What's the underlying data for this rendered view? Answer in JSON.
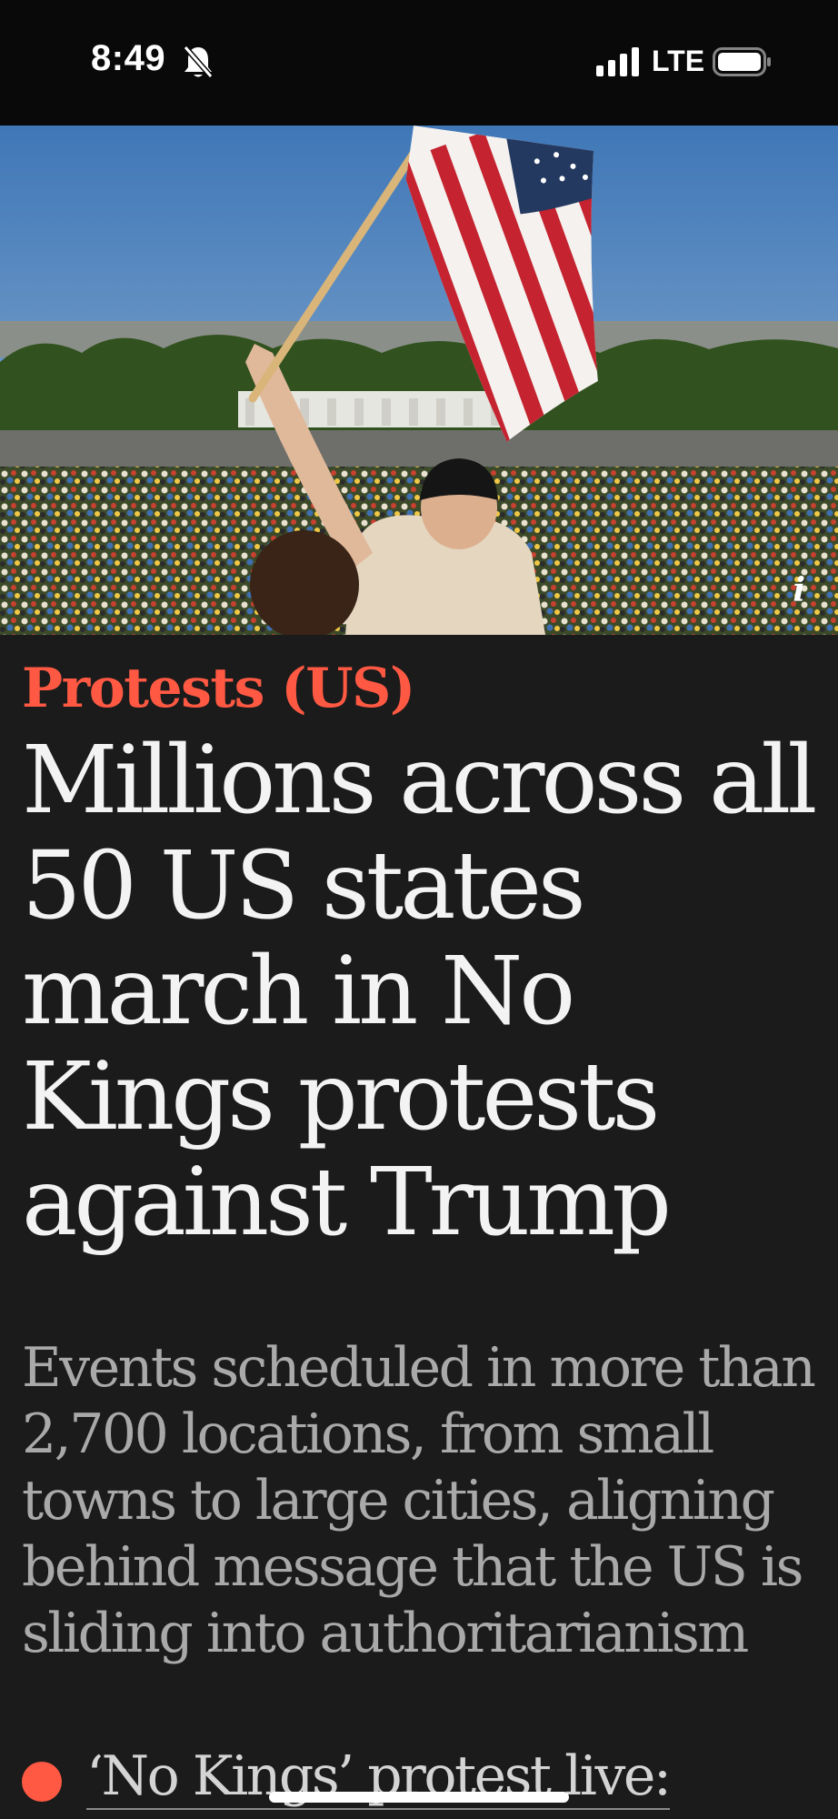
{
  "status_bar": {
    "time": "8:49",
    "network": "LTE",
    "icons": [
      "bell-slash-icon",
      "signal-icon",
      "battery-icon"
    ]
  },
  "hero": {
    "image_description_icon": "info-icon",
    "info_glyph": "i"
  },
  "article": {
    "kicker": "Protests (US)",
    "headline": "Millions across all 50 US states march in No Kings protests against Trump",
    "standfirst": "Events scheduled in more than 2,700 locations, from small towns to large cities, aligning behind message that the US is sliding into authoritarianism",
    "live_link": "‘No Kings’ protest live:"
  },
  "colors": {
    "background": "#1b1b1b",
    "accent": "#ff5943",
    "headline": "#f3f3f3",
    "standfirst": "#a9a9a9"
  }
}
